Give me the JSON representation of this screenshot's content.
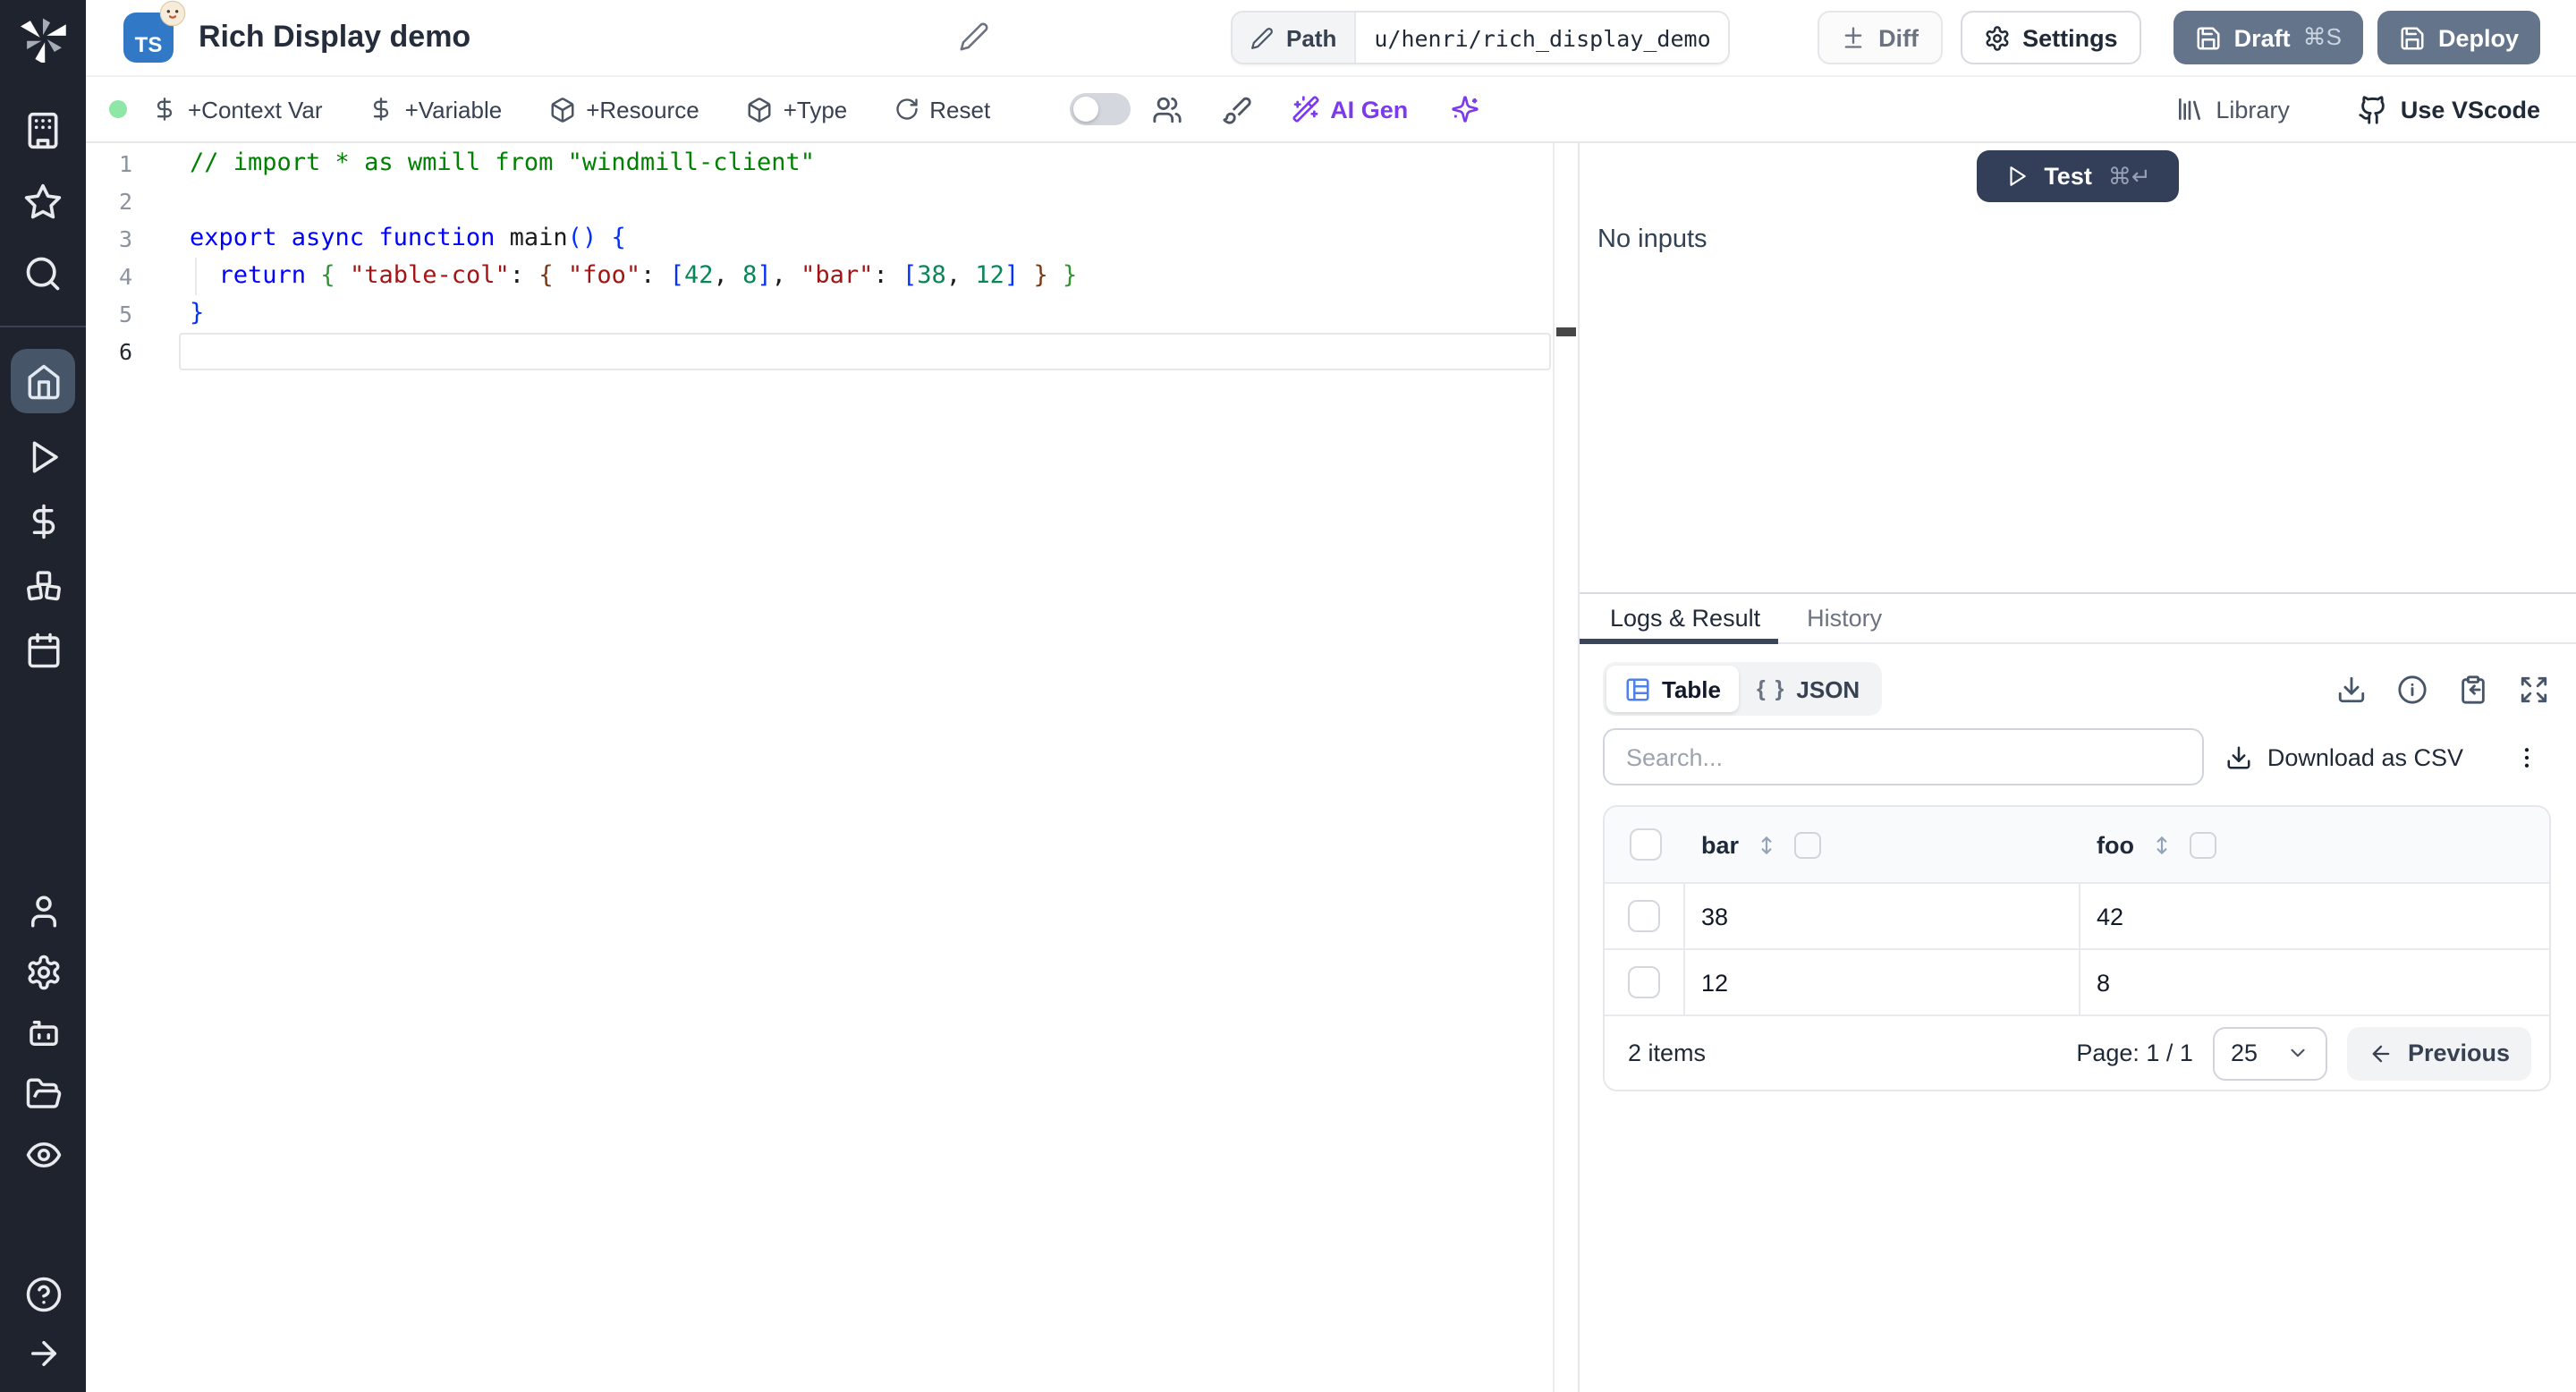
{
  "colors": {
    "sidebar_bg": "#1e232d",
    "sidebar_active_bg": "#475569",
    "ts_badge_bg": "#3178c6",
    "slate_button_bg": "#64748b",
    "test_button_bg": "#333e58",
    "ai_accent": "#7c3aed",
    "status_dot_green": "#8ee7a7",
    "table_icon_blue": "#4e80ee",
    "active_tab_underline": "#3b4758"
  },
  "sidebar": {
    "items": [
      "windmill-logo",
      "workspace",
      "favorites",
      "search",
      "home",
      "runs",
      "variables",
      "resources",
      "schedules",
      "users",
      "settings",
      "workers",
      "folders",
      "audit-logs",
      "help",
      "expand"
    ],
    "active_item": "home"
  },
  "header": {
    "language_badge": "TS",
    "title": "Rich Display demo",
    "path_label": "Path",
    "path_value": "u/henri/rich_display_demo",
    "diff_label": "Diff",
    "settings_label": "Settings",
    "draft_label": "Draft",
    "draft_shortcut": "⌘S",
    "deploy_label": "Deploy"
  },
  "toolbar": {
    "buttons": [
      {
        "label": "+Context Var",
        "icon": "dollar-icon"
      },
      {
        "label": "+Variable",
        "icon": "dollar-icon"
      },
      {
        "label": "+Resource",
        "icon": "package-icon"
      },
      {
        "label": "+Type",
        "icon": "package-icon"
      },
      {
        "label": "Reset",
        "icon": "refresh-icon"
      }
    ],
    "ai_gen_label": "AI Gen",
    "library_label": "Library",
    "vscode_label": "Use VScode"
  },
  "editor": {
    "lines": [
      {
        "num": "1",
        "tokens": [
          [
            "// import * as wmill from \"windmill-client\"",
            "comment"
          ]
        ]
      },
      {
        "num": "2",
        "tokens": []
      },
      {
        "num": "3",
        "tokens": [
          [
            "export async function ",
            "kw"
          ],
          [
            "main",
            "fn"
          ],
          [
            "(",
            "b1"
          ],
          [
            ")",
            "b1"
          ],
          [
            " ",
            "plain"
          ],
          [
            "{",
            "b1"
          ]
        ]
      },
      {
        "num": "4",
        "tokens": [
          [
            "  ",
            "plain"
          ],
          [
            "return",
            "kw"
          ],
          [
            " ",
            "plain"
          ],
          [
            "{",
            "b2"
          ],
          [
            " ",
            "plain"
          ],
          [
            "\"table-col\"",
            "str"
          ],
          [
            ":",
            "plain"
          ],
          [
            " ",
            "plain"
          ],
          [
            "{",
            "b3"
          ],
          [
            " ",
            "plain"
          ],
          [
            "\"foo\"",
            "str"
          ],
          [
            ":",
            "plain"
          ],
          [
            " ",
            "plain"
          ],
          [
            "[",
            "b1"
          ],
          [
            "42",
            "num"
          ],
          [
            ", ",
            "plain"
          ],
          [
            "8",
            "num"
          ],
          [
            "]",
            "b1"
          ],
          [
            ", ",
            "plain"
          ],
          [
            "\"bar\"",
            "str"
          ],
          [
            ":",
            "plain"
          ],
          [
            " ",
            "plain"
          ],
          [
            "[",
            "b1"
          ],
          [
            "38",
            "num"
          ],
          [
            ", ",
            "plain"
          ],
          [
            "12",
            "num"
          ],
          [
            "]",
            "b1"
          ],
          [
            " ",
            "plain"
          ],
          [
            "}",
            "b3"
          ],
          [
            " ",
            "plain"
          ],
          [
            "}",
            "b2"
          ]
        ]
      },
      {
        "num": "5",
        "tokens": [
          [
            "}",
            "b1"
          ]
        ]
      },
      {
        "num": "6",
        "tokens": []
      }
    ]
  },
  "runner": {
    "test_label": "Test",
    "test_shortcut": "⌘↵",
    "no_inputs": "No inputs"
  },
  "results": {
    "tabs": [
      {
        "label": "Logs & Result"
      },
      {
        "label": "History"
      }
    ],
    "active_tab": "Logs & Result",
    "view_tabs": [
      {
        "label": "Table"
      },
      {
        "label": "JSON"
      }
    ],
    "active_view": "Table",
    "braces_glyph": "{ }",
    "search_placeholder": "Search...",
    "download_csv_label": "Download as CSV",
    "table": {
      "columns": [
        "bar",
        "foo"
      ],
      "rows": [
        [
          "38",
          "42"
        ],
        [
          "12",
          "8"
        ]
      ]
    },
    "footer": {
      "items_count": "2 items",
      "page_label": "Page: 1 / 1",
      "page_size": "25",
      "prev_label": "Previous"
    }
  }
}
